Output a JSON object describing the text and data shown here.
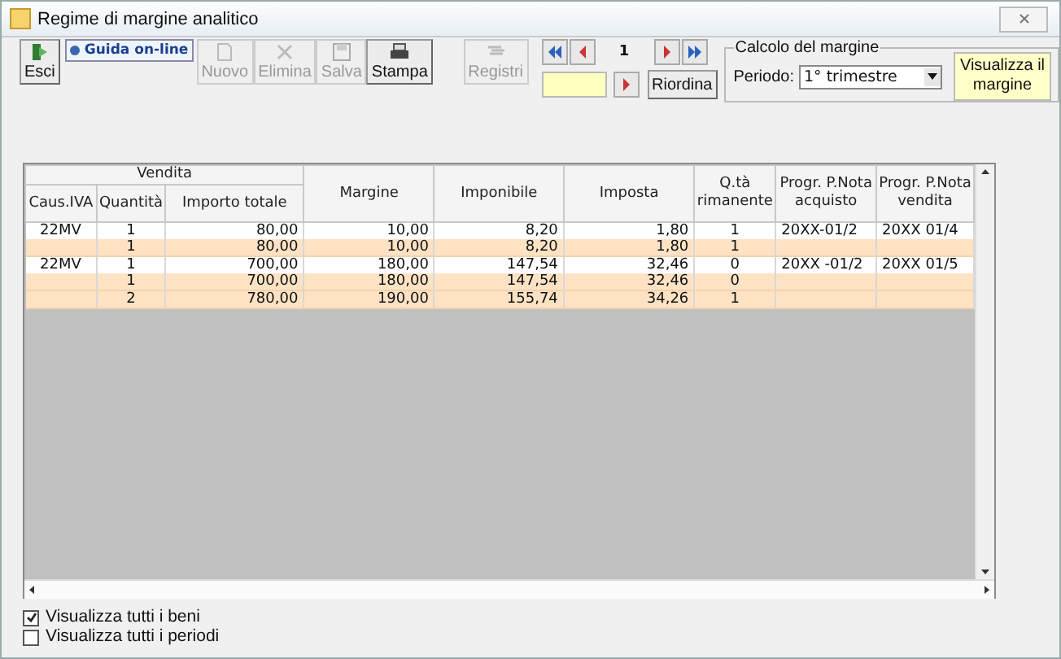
{
  "window": {
    "title": "Regime di margine analitico"
  },
  "toolbar": [
    {
      "label": "Esci",
      "kind": "exit",
      "disabled": false
    },
    {
      "label": "Nuovo",
      "kind": "new",
      "disabled": true
    },
    {
      "label": "Elimina",
      "kind": "delete",
      "disabled": true
    },
    {
      "label": "Salva",
      "kind": "save",
      "disabled": true
    },
    {
      "label": "Stampa",
      "kind": "print",
      "disabled": false
    },
    {
      "label": "Registri",
      "kind": "registers",
      "disabled": true
    }
  ],
  "help_link": "Guida on-line",
  "navigator": {
    "record": "1",
    "sort_button": "Riordina"
  },
  "margin_calc": {
    "title": "Calcolo del margine",
    "period_label": "Periodo:",
    "period_value": "1° trimestre",
    "show_button": "Visualizza il margine"
  },
  "table": {
    "group_header": "Vendita",
    "columns": [
      "Caus.IVA",
      "Quantità",
      "Importo totale",
      "Margine",
      "Imponibile",
      "Imposta",
      "Q.tà rimanente",
      "Progr. P.Nota acquisto",
      "Progr. P.Nota vendita"
    ],
    "rows": [
      {
        "kind": "detail",
        "cells": [
          "22MV",
          "1",
          "80,00",
          "10,00",
          "8,20",
          "1,80",
          "1",
          "20XX-01/2",
          "20XX 01/4"
        ]
      },
      {
        "kind": "total",
        "cells": [
          "",
          "1",
          "80,00",
          "10,00",
          "8,20",
          "1,80",
          "1",
          "",
          ""
        ]
      },
      {
        "kind": "detail",
        "cells": [
          "22MV",
          "1",
          "700,00",
          "180,00",
          "147,54",
          "32,46",
          "0",
          "20XX -01/2",
          "20XX 01/5"
        ]
      },
      {
        "kind": "total",
        "cells": [
          "",
          "1",
          "700,00",
          "180,00",
          "147,54",
          "32,46",
          "0",
          "",
          ""
        ]
      },
      {
        "kind": "total",
        "cells": [
          "",
          "2",
          "780,00",
          "190,00",
          "155,74",
          "34,26",
          "1",
          "",
          ""
        ]
      }
    ]
  },
  "options": [
    {
      "label": "Visualizza tutti i beni",
      "checked": true
    },
    {
      "label": "Visualizza tutti i periodi",
      "checked": false
    }
  ]
}
